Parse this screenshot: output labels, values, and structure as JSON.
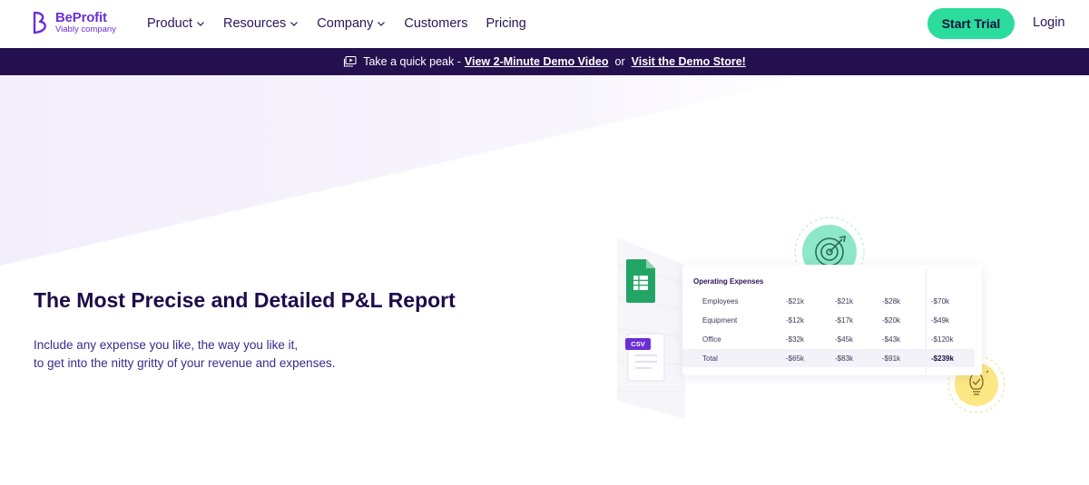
{
  "brand": {
    "name": "BeProfit",
    "subtitle": "Viably company",
    "accent_color": "#6a2fd6"
  },
  "nav": {
    "items": [
      {
        "label": "Product",
        "has_dropdown": true
      },
      {
        "label": "Resources",
        "has_dropdown": true
      },
      {
        "label": "Company",
        "has_dropdown": true
      },
      {
        "label": "Customers",
        "has_dropdown": false
      },
      {
        "label": "Pricing",
        "has_dropdown": false
      }
    ],
    "cta_label": "Start Trial",
    "cta_color": "#2bdc9c",
    "login_label": "Login"
  },
  "banner": {
    "icon": "video-play-icon",
    "lead": "Take a quick peak -",
    "link1": "View 2-Minute Demo Video",
    "or": "or",
    "link2": "Visit the Demo Store!",
    "bg_color": "#25104f"
  },
  "hero": {
    "title": "The Most Precise and Detailed P&L Report",
    "description_lines": [
      "Include any expense you like, the way you like it,",
      "to get into the nitty gritty of your revenue and expenses."
    ]
  },
  "illustration": {
    "table_title": "Operating Expenses",
    "csv_label": "CSV",
    "icons": [
      "google-sheets-icon",
      "csv-file-icon",
      "target-icon",
      "lightbulb-icon"
    ],
    "rows": [
      {
        "label": "Employees",
        "values": [
          "-$21k",
          "-$21k",
          "-$28k",
          "-$70k"
        ]
      },
      {
        "label": "Equipment",
        "values": [
          "-$12k",
          "-$17k",
          "-$20k",
          "-$49k"
        ]
      },
      {
        "label": "Office",
        "values": [
          "-$32k",
          "-$45k",
          "-$43k",
          "-$120k"
        ]
      },
      {
        "label": "Total",
        "values": [
          "-$65k",
          "-$83k",
          "-$91k",
          "-$239k"
        ]
      }
    ]
  }
}
